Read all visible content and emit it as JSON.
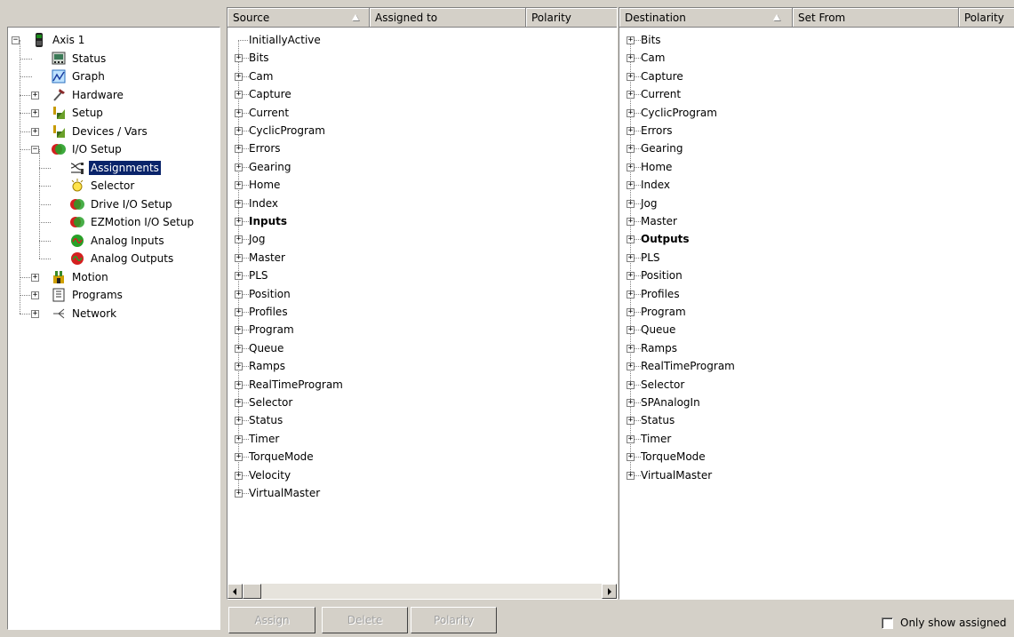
{
  "tree": {
    "items": [
      {
        "label": "Axis 1",
        "icon": "axis-icon",
        "expander": "−",
        "selected": false
      },
      {
        "label": "Status",
        "icon": "status-monitor-icon"
      },
      {
        "label": "Graph",
        "icon": "graph-icon"
      },
      {
        "label": "Hardware",
        "icon": "hardware-tools-icon",
        "expander": "+"
      },
      {
        "label": "Setup",
        "icon": "setup-icon",
        "expander": "+"
      },
      {
        "label": "Devices / Vars",
        "icon": "devices-vars-icon",
        "expander": "+"
      },
      {
        "label": "I/O Setup",
        "icon": "io-setup-icon",
        "expander": "−"
      },
      {
        "label": "Assignments",
        "icon": "assignments-icon",
        "selected": true
      },
      {
        "label": "Selector",
        "icon": "selector-icon"
      },
      {
        "label": "Drive I/O Setup",
        "icon": "drive-io-icon"
      },
      {
        "label": "EZMotion I/O Setup",
        "icon": "ezmotion-io-icon"
      },
      {
        "label": "Analog Inputs",
        "icon": "analog-inputs-icon"
      },
      {
        "label": "Analog Outputs",
        "icon": "analog-outputs-icon"
      },
      {
        "label": "Motion",
        "icon": "motion-icon",
        "expander": "+"
      },
      {
        "label": "Programs",
        "icon": "programs-icon",
        "expander": "+"
      },
      {
        "label": "Network",
        "icon": "network-icon",
        "expander": "+"
      }
    ]
  },
  "source_list": {
    "columns": [
      "Source",
      "Assigned to",
      "Polarity"
    ],
    "items": [
      {
        "label": "InitiallyActive",
        "expandable": false
      },
      {
        "label": "Bits"
      },
      {
        "label": "Cam"
      },
      {
        "label": "Capture"
      },
      {
        "label": "Current"
      },
      {
        "label": "CyclicProgram"
      },
      {
        "label": "Errors"
      },
      {
        "label": "Gearing"
      },
      {
        "label": "Home"
      },
      {
        "label": "Index"
      },
      {
        "label": "Inputs",
        "bold": true
      },
      {
        "label": "Jog"
      },
      {
        "label": "Master"
      },
      {
        "label": "PLS"
      },
      {
        "label": "Position"
      },
      {
        "label": "Profiles"
      },
      {
        "label": "Program"
      },
      {
        "label": "Queue"
      },
      {
        "label": "Ramps"
      },
      {
        "label": "RealTimeProgram"
      },
      {
        "label": "Selector"
      },
      {
        "label": "Status"
      },
      {
        "label": "Timer"
      },
      {
        "label": "TorqueMode"
      },
      {
        "label": "Velocity"
      },
      {
        "label": "VirtualMaster"
      }
    ]
  },
  "destination_list": {
    "columns": [
      "Destination",
      "Set From",
      "Polarity"
    ],
    "items": [
      {
        "label": "Bits"
      },
      {
        "label": "Cam"
      },
      {
        "label": "Capture"
      },
      {
        "label": "Current"
      },
      {
        "label": "CyclicProgram"
      },
      {
        "label": "Errors"
      },
      {
        "label": "Gearing"
      },
      {
        "label": "Home"
      },
      {
        "label": "Index"
      },
      {
        "label": "Jog"
      },
      {
        "label": "Master"
      },
      {
        "label": "Outputs",
        "bold": true
      },
      {
        "label": "PLS"
      },
      {
        "label": "Position"
      },
      {
        "label": "Profiles"
      },
      {
        "label": "Program"
      },
      {
        "label": "Queue"
      },
      {
        "label": "Ramps"
      },
      {
        "label": "RealTimeProgram"
      },
      {
        "label": "Selector"
      },
      {
        "label": "SPAnalogIn"
      },
      {
        "label": "Status"
      },
      {
        "label": "Timer"
      },
      {
        "label": "TorqueMode"
      },
      {
        "label": "VirtualMaster"
      }
    ]
  },
  "buttons": {
    "assign": "Assign",
    "delete": "Delete",
    "polarity": "Polarity"
  },
  "only_show_assigned": {
    "label": "Only show assigned",
    "checked": false
  },
  "colors": {
    "selection": "#0a246a",
    "disabled_text": "#a0a0a0",
    "panel": "#d4d0c8"
  }
}
